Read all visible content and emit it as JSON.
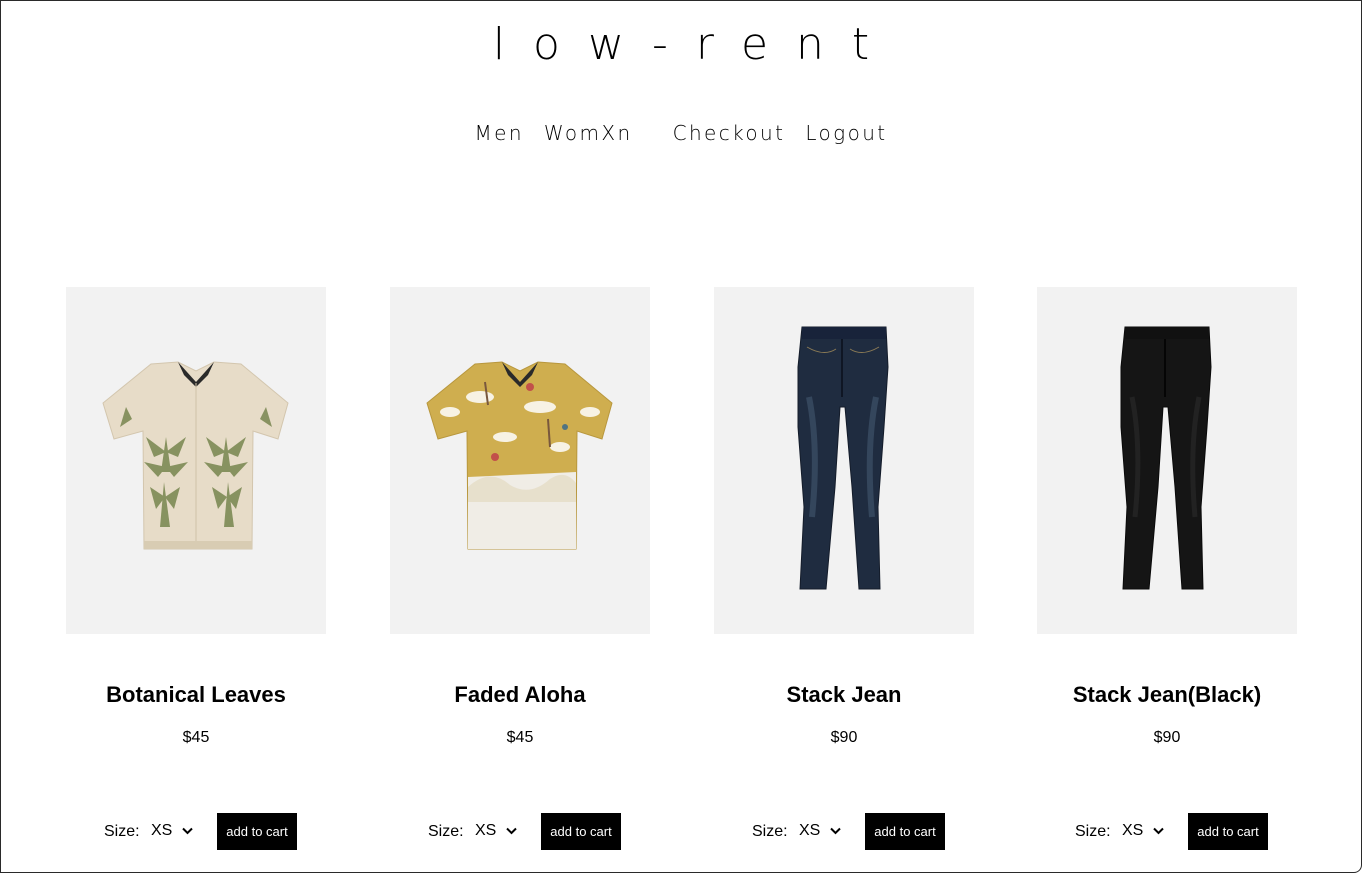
{
  "brand": {
    "logo": "low-rent"
  },
  "nav": {
    "men": "Men",
    "women": "WomXn",
    "checkout": "Checkout",
    "logout": "Logout"
  },
  "products": [
    {
      "name": "Botanical Leaves",
      "price": "$45",
      "size_label": "Size:",
      "size_value": "XS",
      "cart_label": "add to cart",
      "image": "cream-botanical-print-shirt"
    },
    {
      "name": "Faded Aloha",
      "price": "$45",
      "size_label": "Size:",
      "size_value": "XS",
      "cart_label": "add to cart",
      "image": "yellow-aloha-print-shirt"
    },
    {
      "name": "Stack Jean",
      "price": "$90",
      "size_label": "Size:",
      "size_value": "XS",
      "cart_label": "add to cart",
      "image": "dark-blue-skinny-jeans"
    },
    {
      "name": "Stack Jean(Black)",
      "price": "$90",
      "size_label": "Size:",
      "size_value": "XS",
      "cart_label": "add to cart",
      "image": "black-skinny-jeans"
    }
  ]
}
